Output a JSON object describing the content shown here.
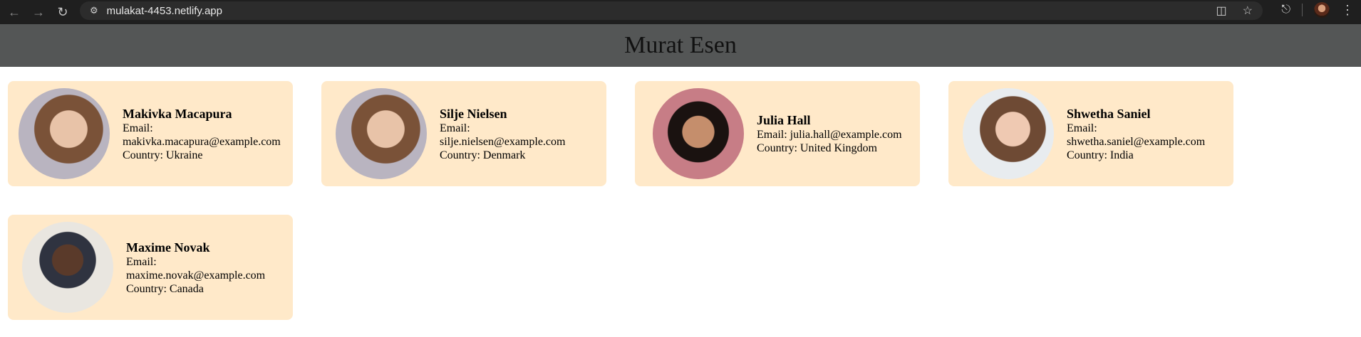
{
  "browser": {
    "url": "mulakat-4453.netlify.app",
    "icons": [
      "back-icon",
      "forward-icon",
      "reload-icon",
      "site-info-icon",
      "install-icon",
      "bookmark-star-icon",
      "extensions-icon",
      "profile-avatar",
      "menu-icon"
    ]
  },
  "page": {
    "title": "Murat Esen"
  },
  "labels": {
    "email": "Email:",
    "country": "Country:"
  },
  "users": [
    {
      "name": "Makivka Macapura",
      "email": "makivka.macapura@example.com",
      "country": "Ukraine",
      "photo": "woman-portrait"
    },
    {
      "name": "Silje Nielsen",
      "email": "silje.nielsen@example.com",
      "country": "Denmark",
      "photo": "woman-portrait"
    },
    {
      "name": "Julia Hall",
      "email": "julia.hall@example.com",
      "country": "United Kingdom",
      "photo": "woman-portrait-smiling"
    },
    {
      "name": "Shwetha Saniel",
      "email": "shwetha.saniel@example.com",
      "country": "India",
      "photo": "woman-portrait"
    },
    {
      "name": "Maxime Novak",
      "email": "maxime.novak@example.com",
      "country": "Canada",
      "photo": "man-portrait"
    }
  ],
  "colors": {
    "header_bg": "#545656",
    "card_bg": "#ffe9c9",
    "chrome_bg": "#1f1f1f"
  }
}
